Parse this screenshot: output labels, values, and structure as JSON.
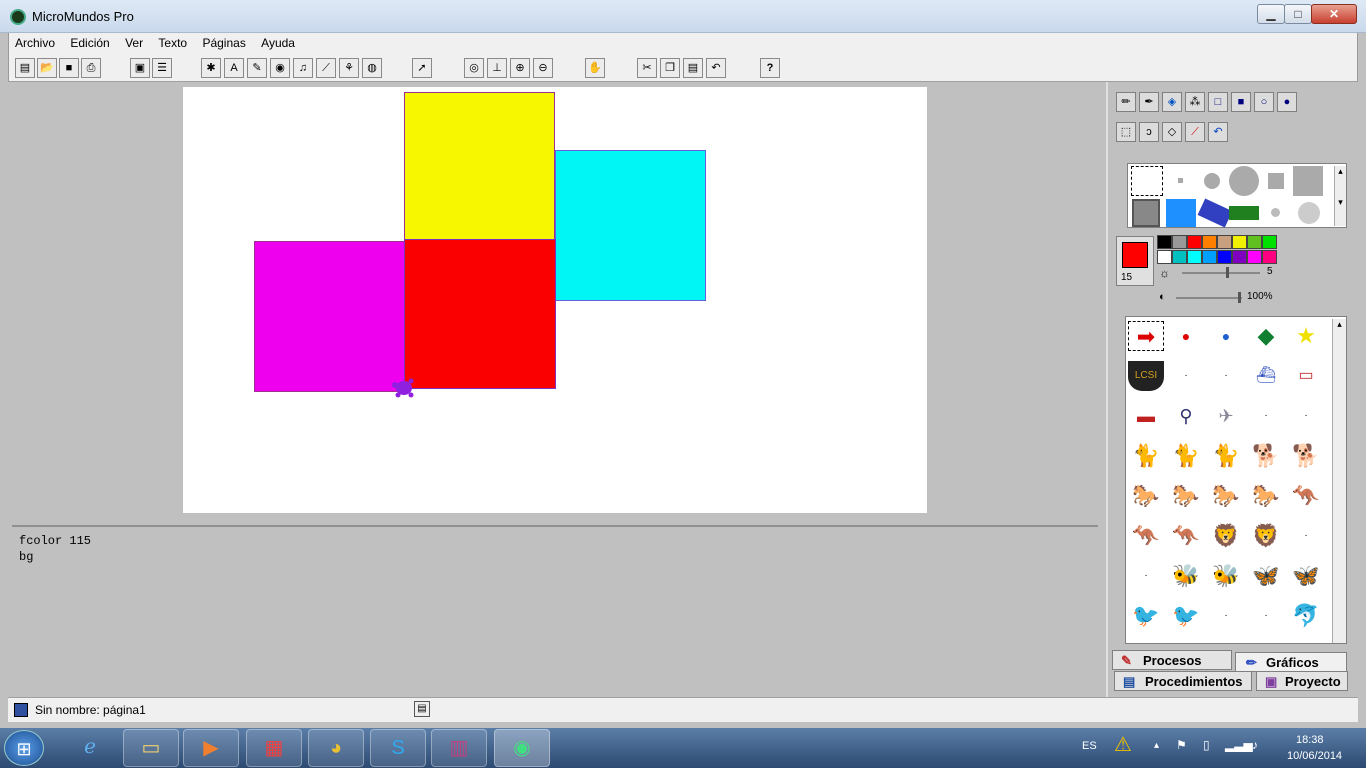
{
  "window": {
    "title": "MicroMundos Pro",
    "min_glyph": "▁",
    "max_glyph": "□",
    "close_glyph": "✕"
  },
  "menu": [
    "Archivo",
    "Edición",
    "Ver",
    "Texto",
    "Páginas",
    "Ayuda"
  ],
  "toolbar_icons": [
    "new-page-icon",
    "open-icon",
    "save-icon",
    "print-icon",
    "page-icon",
    "page-list-icon",
    "turtle-icon",
    "text-box-icon",
    "paint-icon",
    "video-icon",
    "music-icon",
    "slider-icon",
    "movie-icon",
    "web-icon",
    "pointer-icon",
    "eye-icon",
    "stamp-icon",
    "zoom-in-icon",
    "zoom-out-icon",
    "stop-icon",
    "cut-icon",
    "copy-icon",
    "paste-icon",
    "undo-icon",
    "help-icon"
  ],
  "canvas": {
    "squares": [
      {
        "name": "yellow-square",
        "color": "#f7f700"
      },
      {
        "name": "cyan-square",
        "color": "#00f5f5"
      },
      {
        "name": "magenta-square",
        "color": "#ee00ee"
      },
      {
        "name": "red-square",
        "color": "#fb0000"
      }
    ],
    "turtle_color": "#9020e0"
  },
  "command_center": {
    "lines": [
      "fcolor 115",
      "bg"
    ]
  },
  "paint_tools": [
    "pencil-icon",
    "pen-icon",
    "fill-bucket-icon",
    "spray-icon",
    "outline-rect-icon",
    "filled-rect-icon",
    "outline-circle-icon",
    "filled-circle-icon",
    "select-icon",
    "lasso-icon",
    "eraser-icon",
    "eyedropper-icon",
    "undo-paint-icon"
  ],
  "color_panel": {
    "current_color": "#ff0000",
    "current_number": "15",
    "palette": [
      "#000000",
      "#999999",
      "#ff0000",
      "#ff8000",
      "#c8a080",
      "#f0f000",
      "#60c020",
      "#00e000",
      "#ffffff",
      "#00c0c0",
      "#00ffff",
      "#00a0ff",
      "#0000ff",
      "#8000c0",
      "#ff00ff",
      "#ff0080"
    ],
    "size_value": "5",
    "opacity_value": "100%"
  },
  "tabs": {
    "procesos": "Procesos",
    "graficos": "Gráficos",
    "procedimientos": "Procedimientos",
    "proyecto": "Proyecto"
  },
  "status": {
    "text": "Sin nombre:  página1"
  },
  "taskbar": {
    "apps": [
      "start-button",
      "internet-explorer",
      "file-explorer",
      "media-player",
      "app-grid",
      "chrome",
      "skype",
      "winrar",
      "micromundos"
    ],
    "lang": "ES",
    "time": "18:38",
    "date": "10/06/2014"
  }
}
